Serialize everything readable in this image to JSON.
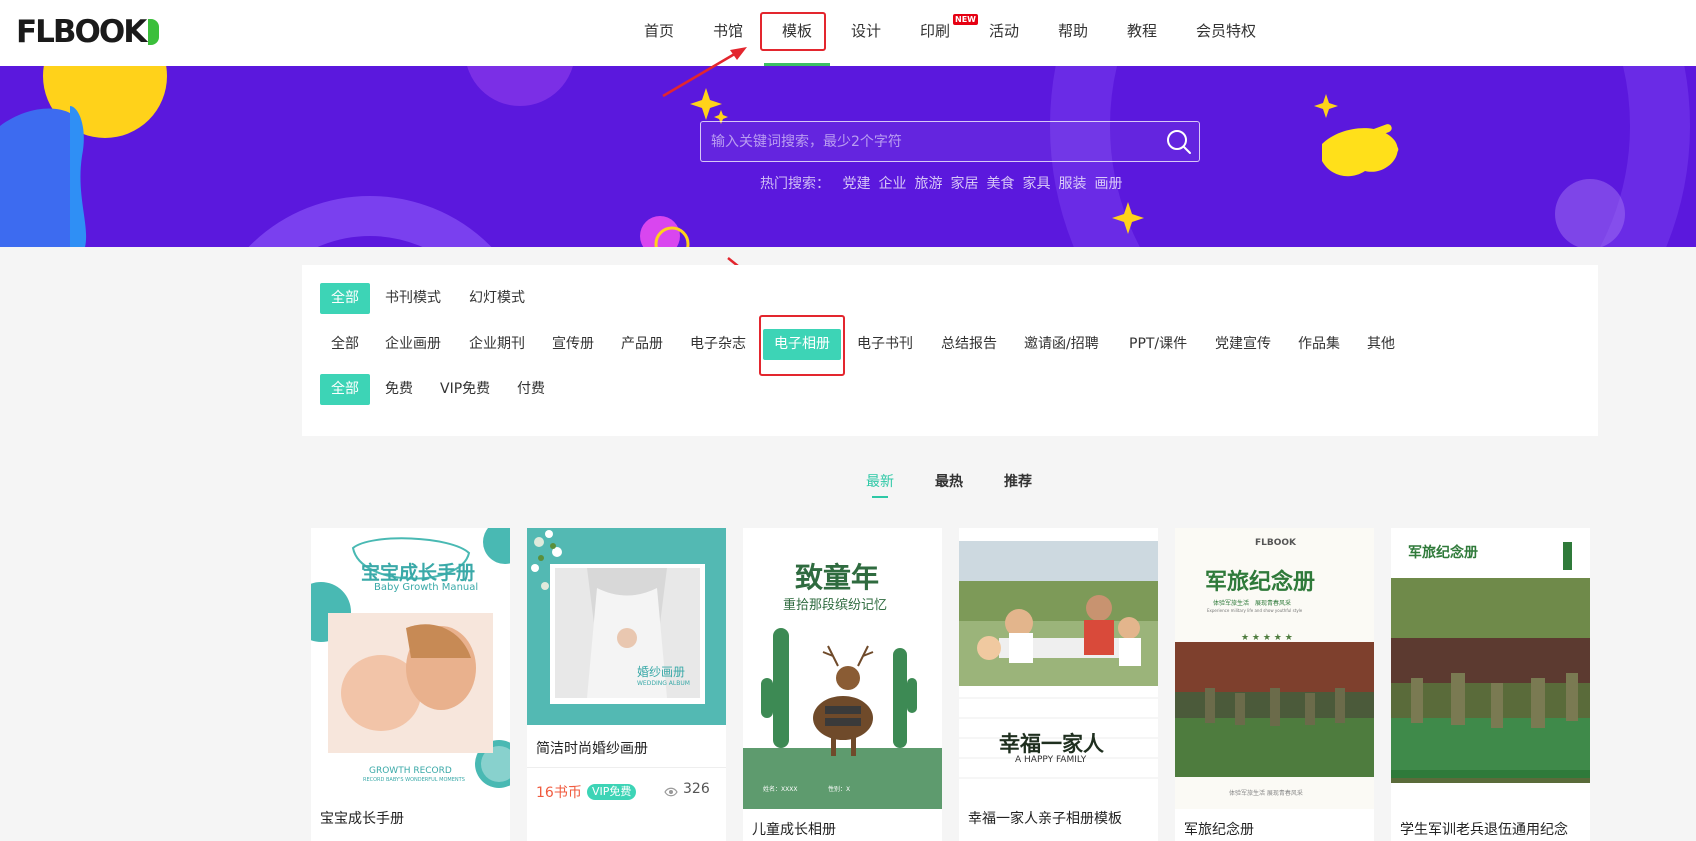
{
  "logo": "FLBOOK",
  "nav": {
    "items": [
      "首页",
      "书馆",
      "模板",
      "设计",
      "印刷",
      "活动",
      "帮助",
      "教程",
      "会员特权"
    ],
    "badge": "NEW"
  },
  "search": {
    "placeholder": "输入关键词搜索，最少2个字符",
    "hot_label": "热门搜索：",
    "hot_terms": [
      "党建",
      "企业",
      "旅游",
      "家居",
      "美食",
      "家具",
      "服装",
      "画册"
    ]
  },
  "filters": {
    "mode": [
      "全部",
      "书刊模式",
      "幻灯模式"
    ],
    "category": [
      "全部",
      "企业画册",
      "企业期刊",
      "宣传册",
      "产品册",
      "电子杂志",
      "电子相册",
      "电子书刊",
      "总结报告",
      "邀请函/招聘",
      "PPT/课件",
      "党建宣传",
      "作品集",
      "其他"
    ],
    "price": [
      "全部",
      "免费",
      "VIP免费",
      "付费"
    ],
    "active_mode": "全部",
    "active_category": "电子相册",
    "active_price": "全部"
  },
  "sort": {
    "tabs": [
      "最新",
      "最热",
      "推荐"
    ],
    "active": "最新"
  },
  "cards": [
    {
      "title": "宝宝成长手册",
      "thumb_text": {
        "heading": "宝宝成长手册",
        "sub": "Baby Growth Manual",
        "footer": "GROWTH RECORD",
        "footer_sub": "RECORD BABY'S WONDERFUL MOMENTS"
      }
    },
    {
      "title": "简洁时尚婚纱画册",
      "price": "16书币",
      "vip": "VIP免费",
      "views": "326",
      "thumb_text": {
        "heading": "婚纱画册",
        "sub": "WEDDING ALBUM"
      }
    },
    {
      "title": "儿童成长相册",
      "thumb_text": {
        "heading": "致童年",
        "sub": "重拾那段缤纷记忆",
        "f1": "姓名：XXXX",
        "f2": "性别：X"
      }
    },
    {
      "title": "幸福一家人亲子相册模板",
      "thumb_text": {
        "heading": "幸福一家人",
        "sub": "A HAPPY FAMILY"
      }
    },
    {
      "title": "军旅纪念册",
      "thumb_text": {
        "brand": "FLBOOK",
        "heading": "军旅纪念册",
        "sub": "体验军旅生活　展现青春风采",
        "sub2": "Experience military life and show youthful style",
        "footer": "体验军旅生活 展现青春风采"
      }
    },
    {
      "title": "学生军训老兵退伍通用纪念",
      "thumb_text": {
        "heading": "军旅纪念册"
      }
    }
  ],
  "colors": {
    "accent": "#3dd4b6",
    "banner": "#5b18dd",
    "highlight": "#e3262e",
    "nav_underline": "#3cbf63",
    "price": "#f05b3f"
  }
}
